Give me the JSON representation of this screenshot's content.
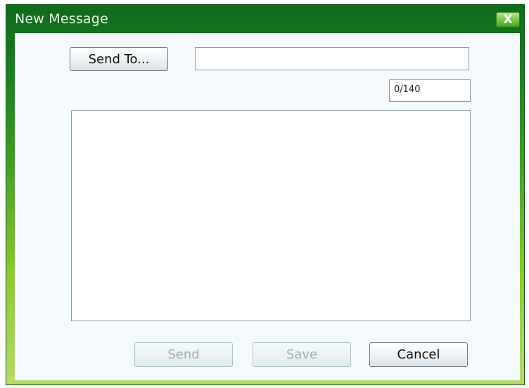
{
  "window": {
    "title": "New Message",
    "close_label": "X"
  },
  "form": {
    "send_to_label": "Send To...",
    "recipient_value": "",
    "char_counter": "0/140",
    "message_value": ""
  },
  "buttons": {
    "send_label": "Send",
    "save_label": "Save",
    "cancel_label": "Cancel"
  },
  "colors": {
    "titlebar_dark": "#0f6a1c",
    "titlebar_light": "#b9d96f",
    "client_bg": "#f4f9fd"
  }
}
